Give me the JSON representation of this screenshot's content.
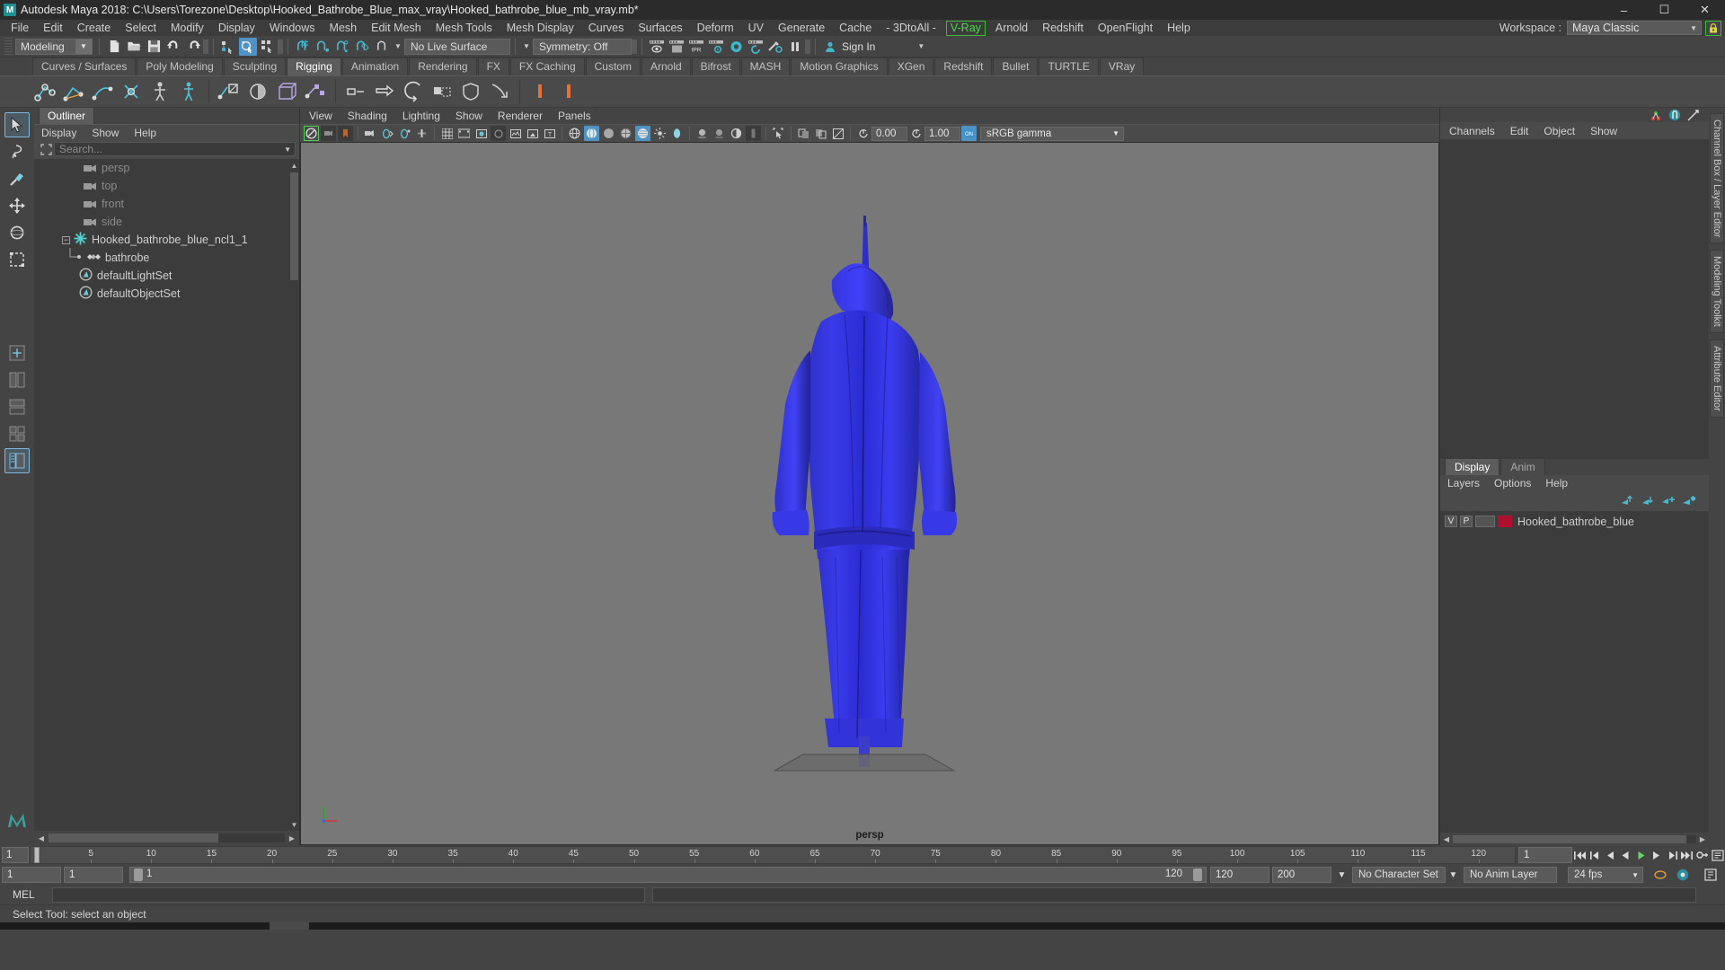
{
  "window": {
    "title": "Autodesk Maya 2018: C:\\Users\\Torezone\\Desktop\\Hooked_Bathrobe_Blue_max_vray\\Hooked_bathrobe_blue_mb_vray.mb*",
    "logo": "M",
    "minimize": "–",
    "maximize": "☐",
    "close": "✕"
  },
  "menubar": {
    "items": [
      "File",
      "Edit",
      "Create",
      "Select",
      "Modify",
      "Display",
      "Windows",
      "Mesh",
      "Edit Mesh",
      "Mesh Tools",
      "Mesh Display",
      "Curves",
      "Surfaces",
      "Deform",
      "UV",
      "Generate",
      "Cache",
      "- 3DtoAll -"
    ],
    "vray": "V-Ray",
    "items_after": [
      "Arnold",
      "Redshift",
      "OpenFlight",
      "Help"
    ],
    "workspace_label": "Workspace :",
    "workspace_value": "Maya Classic",
    "lock_icon": "lock-icon"
  },
  "statusbar": {
    "mode": "Modeling",
    "live_surface": "No Live Surface",
    "symmetry": "Symmetry: Off",
    "sign_in": "Sign In",
    "ipr_label": "IPR"
  },
  "shelf": {
    "tabs": [
      "Curves / Surfaces",
      "Poly Modeling",
      "Sculpting",
      "Rigging",
      "Animation",
      "Rendering",
      "FX",
      "FX Caching",
      "Custom",
      "Arnold",
      "Bifrost",
      "MASH",
      "Motion Graphics",
      "XGen",
      "Redshift",
      "Bullet",
      "TURTLE",
      "VRay"
    ],
    "active_tab": "Rigging"
  },
  "outliner": {
    "tab": "Outliner",
    "menu": [
      "Display",
      "Show",
      "Help"
    ],
    "search_placeholder": "Search...",
    "items": [
      {
        "label": "persp",
        "icon": "camera-icon",
        "dim": true,
        "indent": 1
      },
      {
        "label": "top",
        "icon": "camera-icon",
        "dim": true,
        "indent": 1
      },
      {
        "label": "front",
        "icon": "camera-icon",
        "dim": true,
        "indent": 1
      },
      {
        "label": "side",
        "icon": "camera-icon",
        "dim": true,
        "indent": 1
      },
      {
        "label": "Hooked_bathrobe_blue_ncl1_1",
        "icon": "ncloth-icon",
        "dim": false,
        "indent": 0,
        "expanded": true
      },
      {
        "label": "bathrobe",
        "icon": "mesh-icon",
        "dim": false,
        "indent": 2
      },
      {
        "label": "defaultLightSet",
        "icon": "set-icon",
        "dim": false,
        "indent": 1
      },
      {
        "label": "defaultObjectSet",
        "icon": "set-icon",
        "dim": false,
        "indent": 1
      }
    ]
  },
  "viewport": {
    "menu": [
      "View",
      "Shading",
      "Lighting",
      "Show",
      "Renderer",
      "Panels"
    ],
    "exposure": "0.00",
    "gamma": "1.00",
    "color_space": "sRGB gamma",
    "camera_label": "persp",
    "background_color": "#787878",
    "object_color": "#2b2ce0"
  },
  "channelbox": {
    "tab_label": "Channel Box / Layer Editor",
    "menu": [
      "Channels",
      "Edit",
      "Object",
      "Show"
    ]
  },
  "vertical_tabs": [
    "Channel Box / Layer Editor",
    "Modeling Toolkit",
    "Attribute Editor"
  ],
  "layers": {
    "tabs": [
      "Display",
      "Anim"
    ],
    "active_tab": "Display",
    "menu": [
      "Layers",
      "Options",
      "Help"
    ],
    "rows": [
      {
        "v": "V",
        "p": "P",
        "color": "#b01030",
        "name": "Hooked_bathrobe_blue"
      }
    ]
  },
  "timeslider": {
    "current_frame": "1",
    "ticks": [
      "5",
      "10",
      "15",
      "20",
      "25",
      "30",
      "35",
      "40",
      "45",
      "50",
      "55",
      "60",
      "65",
      "70",
      "75",
      "80",
      "85",
      "90",
      "95",
      "100",
      "105",
      "110",
      "115",
      "120"
    ],
    "frame_field": "1"
  },
  "rangeslider": {
    "start": "1",
    "start2": "1",
    "bar_start": "1",
    "bar_end": "120",
    "end_field": "120",
    "end_field2": "200",
    "character_set": "No Character Set",
    "anim_layer": "No Anim Layer",
    "fps": "24 fps"
  },
  "commandline": {
    "label": "MEL"
  },
  "helpline": {
    "text": "Select Tool: select an object"
  }
}
